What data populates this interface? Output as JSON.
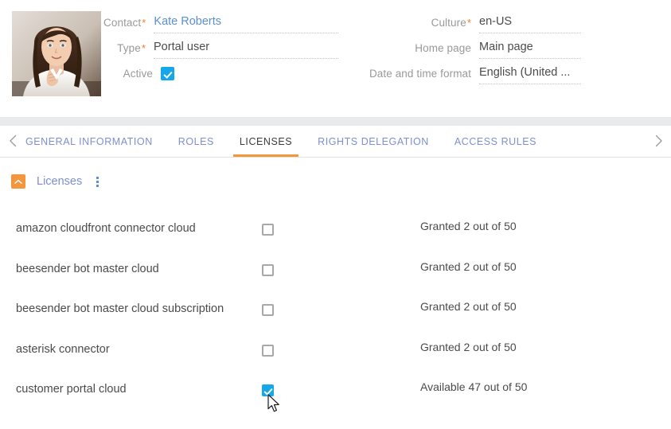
{
  "header": {
    "avatar_alt": "contact-photo",
    "left_fields": [
      {
        "label": "Contact",
        "required": true,
        "value": "Kate Roberts",
        "is_link": true,
        "type": "text"
      },
      {
        "label": "Type",
        "required": true,
        "value": "Portal user",
        "is_link": false,
        "type": "text"
      },
      {
        "label": "Active",
        "required": false,
        "value": "",
        "is_link": false,
        "type": "checkbox",
        "checked": true
      }
    ],
    "right_fields": [
      {
        "label": "Culture",
        "required": true,
        "value": "en-US",
        "is_link": false,
        "type": "text"
      },
      {
        "label": "Home page",
        "required": false,
        "value": "Main page",
        "is_link": false,
        "type": "text"
      },
      {
        "label": "Date and time format",
        "required": false,
        "value": "English (United ...",
        "is_link": false,
        "type": "text"
      }
    ]
  },
  "tabs": {
    "prev_icon": "chevron-left-icon",
    "next_icon": "chevron-right-icon",
    "items": [
      {
        "label": "GENERAL INFORMATION",
        "active": false
      },
      {
        "label": "ROLES",
        "active": false
      },
      {
        "label": "LICENSES",
        "active": true
      },
      {
        "label": "RIGHTS DELEGATION",
        "active": false
      },
      {
        "label": "ACCESS RULES",
        "active": false
      }
    ]
  },
  "section": {
    "collapse_icon": "chevron-up-icon",
    "title": "Licenses",
    "menu_icon": "kebab-menu-icon"
  },
  "licenses": {
    "rows": [
      {
        "name": "amazon cloudfront connector cloud",
        "checked": false,
        "status": "Granted 2 out of 50"
      },
      {
        "name": "beesender bot master cloud",
        "checked": false,
        "status": "Granted 2 out of 50"
      },
      {
        "name": "beesender bot master cloud subscription",
        "checked": false,
        "status": "Granted 2 out of 50"
      },
      {
        "name": "asterisk connector",
        "checked": false,
        "status": "Granted 2 out of 50"
      },
      {
        "name": "customer portal cloud",
        "checked": true,
        "status": "Available 47 out of 50"
      }
    ]
  },
  "colors": {
    "accent_orange": "#f5953c",
    "link_blue": "#5b8fd6",
    "tab_blue": "#7d8fd1",
    "checkbox_blue": "#15a7e8",
    "required_star": "#fa7c25",
    "band_gray": "#e8eaec"
  },
  "cursor": {
    "icon": "mouse-pointer-icon"
  }
}
